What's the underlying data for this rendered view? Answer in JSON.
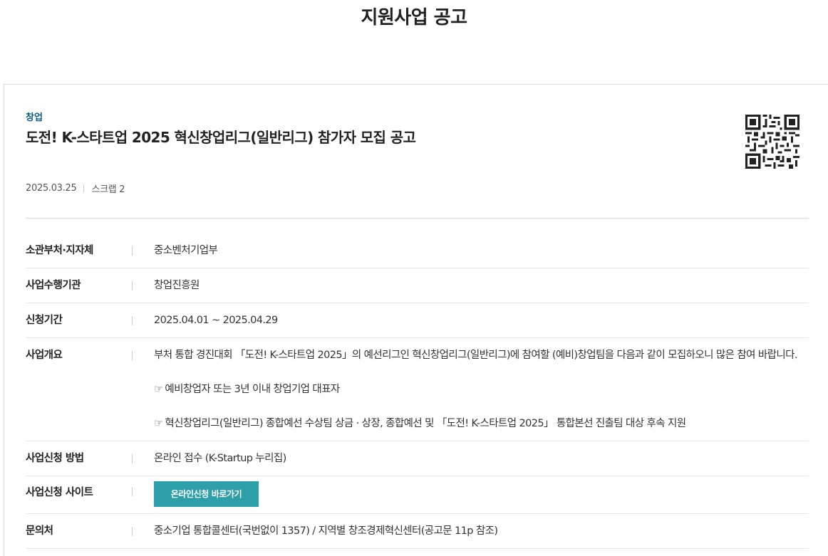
{
  "page": {
    "title": "지원사업 공고"
  },
  "notice": {
    "category": "창업",
    "title": "도전! K-스타트업 2025 혁신창업리그(일반리그) 참가자 모집 공고",
    "date": "2025.03.25",
    "scrap": "스크랩 2",
    "qr_icon": "qr-code-icon"
  },
  "info": {
    "ministry_label": "소관부처·지자체",
    "ministry_value": "중소벤처기업부",
    "agency_label": "사업수행기관",
    "agency_value": "창업진흥원",
    "period_label": "신청기간",
    "period_value": "2025.04.01 ~ 2025.04.29",
    "overview_label": "사업개요",
    "overview_line1": "부처 통합 경진대회 「도전! K-스타트업 2025」의 예선리그인 혁신창업리그(일반리그)에 참여할 (예비)창업팀을 다음과 같이 모집하오니 많은 참여 바랍니다.",
    "bullet_symbol": "☞",
    "overview_bullet1": "예비창업자 또는 3년 이내 창업기업 대표자",
    "overview_bullet2": "혁신창업리그(일반리그) 종합예선 수상팀 상금 · 상장, 종합예선 및 「도전! K-스타트업 2025」 통합본선 진출팀 대상 후속 지원",
    "method_label": "사업신청 방법",
    "method_value": "온라인 접수 (K-Startup 누리집)",
    "site_label": "사업신청 사이트",
    "site_button": "온라인신청 바로가기",
    "contact_label": "문의처",
    "contact_value": "중소기업 통합콜센터(국번없이 1357) / 지역별 창조경제혁신센터(공고문 11p 참조)"
  },
  "colors": {
    "accent": "#2d9fa9",
    "category": "#0b5a8a"
  }
}
